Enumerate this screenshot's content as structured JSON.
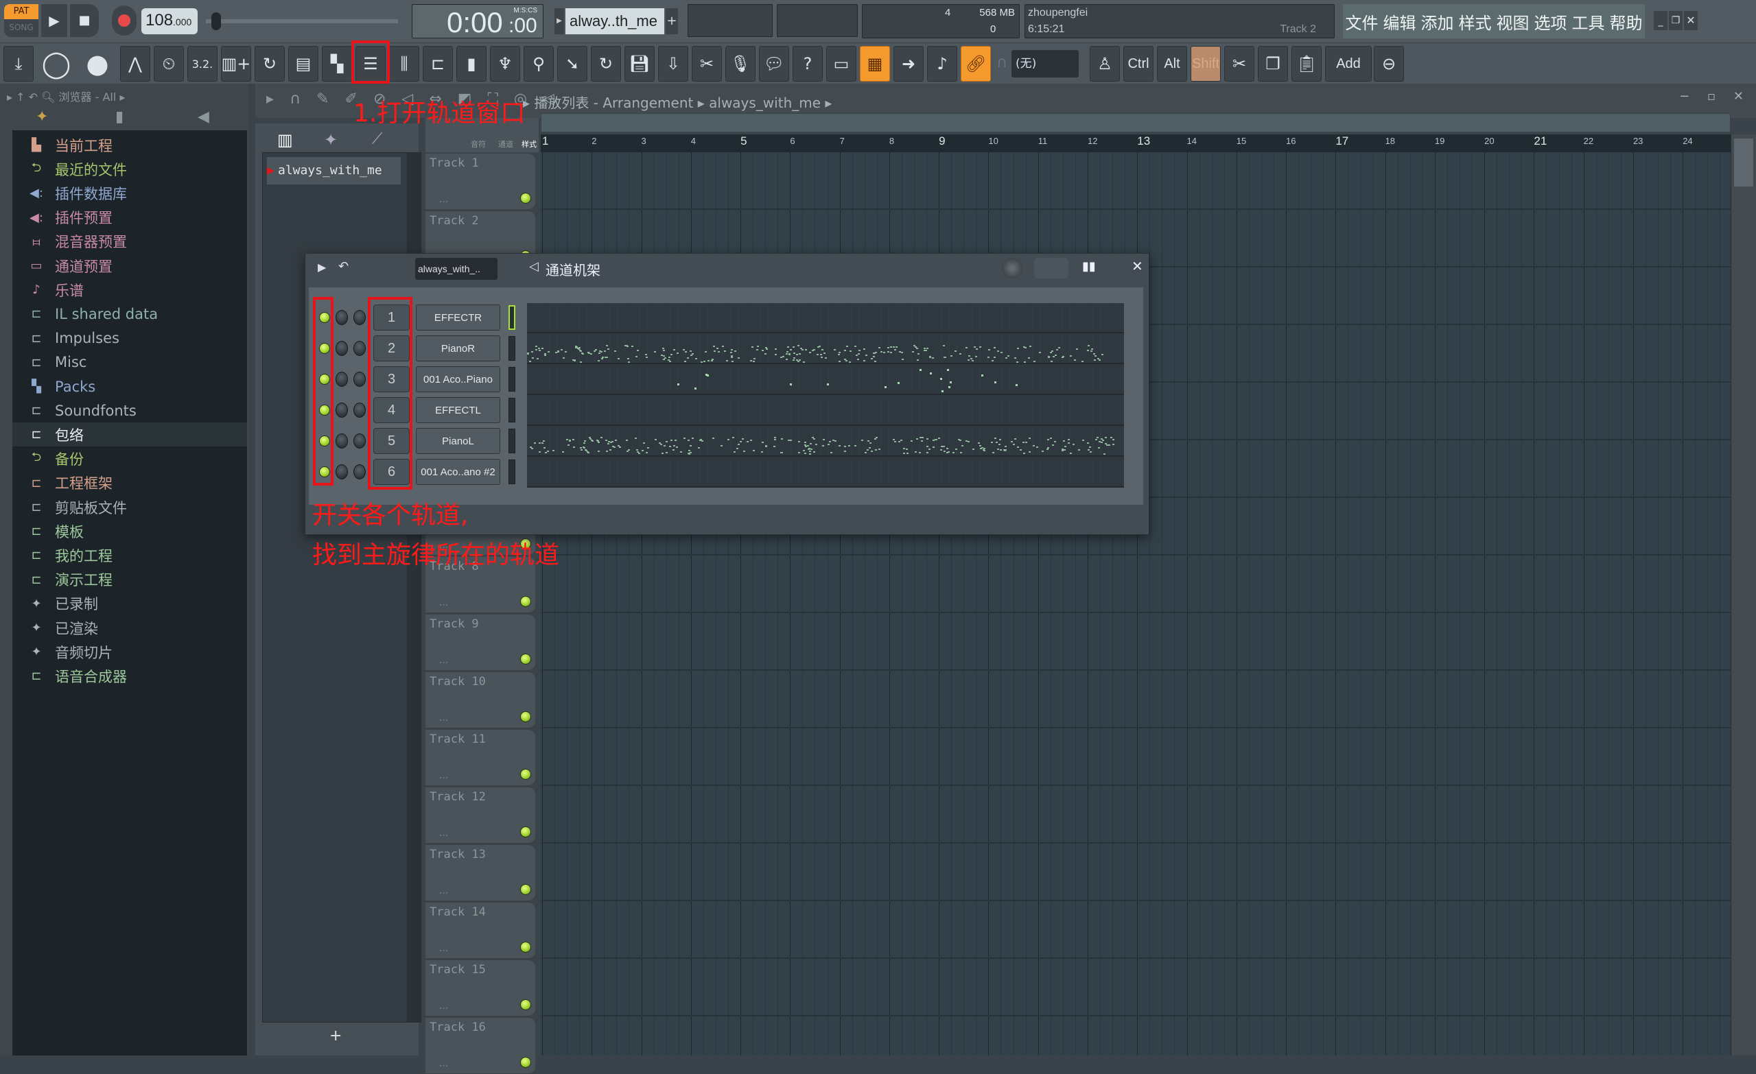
{
  "transport": {
    "pat": "PAT",
    "song": "SONG",
    "tempo": "108",
    "tempo_decimals": ".000",
    "time": "0:00",
    "time_cs": ":00",
    "time_format": "M:S:CS",
    "pattern": "alway..th_me",
    "pattern_add": "+"
  },
  "cpu": {
    "voices": "4",
    "memory": "568 MB",
    "poly": "0"
  },
  "hint": {
    "user": "zhoupengfei",
    "time": "6:15:21",
    "track": "Track 2"
  },
  "menu": [
    "文件",
    "编辑",
    "添加",
    "样式",
    "视图",
    "选项",
    "工具",
    "帮助"
  ],
  "toolbar": {
    "dropdown": "(无)",
    "ctrl": "Ctrl",
    "alt": "Alt",
    "shift": "Shift",
    "add": "Add"
  },
  "browser": {
    "title": "浏览器 - All",
    "items": [
      {
        "label": "当前工程",
        "icon": "project-icon",
        "color": "#d4a08a"
      },
      {
        "label": "最近的文件",
        "icon": "folder-recent-icon",
        "color": "#a6c56d"
      },
      {
        "label": "插件数据库",
        "icon": "plugin-icon",
        "color": "#8fa8d0"
      },
      {
        "label": "插件预置",
        "icon": "plugin-icon",
        "color": "#c88aa8"
      },
      {
        "label": "混音器预置",
        "icon": "mixer-icon",
        "color": "#c88aa8"
      },
      {
        "label": "通道预置",
        "icon": "channel-icon",
        "color": "#c88aa8"
      },
      {
        "label": "乐谱",
        "icon": "note-icon",
        "color": "#c88aa8"
      },
      {
        "label": "IL shared data",
        "icon": "folder-icon",
        "color": "#8fb0b0"
      },
      {
        "label": "Impulses",
        "icon": "folder-icon",
        "color": "#a9b4ba"
      },
      {
        "label": "Misc",
        "icon": "folder-icon",
        "color": "#a9b4ba"
      },
      {
        "label": "Packs",
        "icon": "packs-icon",
        "color": "#8fa8d0"
      },
      {
        "label": "Soundfonts",
        "icon": "folder-icon",
        "color": "#a9b4ba"
      },
      {
        "label": "包络",
        "icon": "folder-icon",
        "color": "#e8eef0"
      },
      {
        "label": "备份",
        "icon": "folder-recent-icon",
        "color": "#a6c56d"
      },
      {
        "label": "工程框架",
        "icon": "folder-icon",
        "color": "#d4a08a"
      },
      {
        "label": "剪贴板文件",
        "icon": "folder-icon",
        "color": "#a9b4ba"
      },
      {
        "label": "模板",
        "icon": "folder-icon",
        "color": "#9cc89a"
      },
      {
        "label": "我的工程",
        "icon": "folder-icon",
        "color": "#9cc89a"
      },
      {
        "label": "演示工程",
        "icon": "folder-icon",
        "color": "#9cc89a"
      },
      {
        "label": "已录制",
        "icon": "wave-icon",
        "color": "#a9b4ba"
      },
      {
        "label": "已渲染",
        "icon": "wave-icon",
        "color": "#a9b4ba"
      },
      {
        "label": "音频切片",
        "icon": "wave-icon",
        "color": "#a9b4ba"
      },
      {
        "label": "语音合成器",
        "icon": "folder-icon",
        "color": "#9cc89a"
      }
    ]
  },
  "playlist": {
    "breadcrumb": "播放列表 - Arrangement",
    "pattern": "always_with_me",
    "tabs": [
      "音符",
      "通道",
      "样式"
    ],
    "pattern_item": "always_with_me",
    "tracks": [
      {
        "n": 1,
        "label": "Track 1"
      },
      {
        "n": 2,
        "label": "Track 2"
      },
      {
        "n": 8,
        "label": "Track 8"
      },
      {
        "n": 9,
        "label": "Track 9"
      },
      {
        "n": 10,
        "label": "Track 10"
      },
      {
        "n": 11,
        "label": "Track 11"
      },
      {
        "n": 12,
        "label": "Track 12"
      },
      {
        "n": 13,
        "label": "Track 13"
      },
      {
        "n": 14,
        "label": "Track 14"
      },
      {
        "n": 15,
        "label": "Track 15"
      },
      {
        "n": 16,
        "label": "Track 16"
      }
    ],
    "bars": [
      1,
      2,
      3,
      4,
      5,
      6,
      7,
      8,
      9,
      10,
      11,
      12,
      13,
      14,
      15,
      16,
      17,
      18,
      19,
      20,
      21,
      22,
      23,
      24
    ]
  },
  "rack": {
    "title": "通道机架",
    "pattern": "always_with_..",
    "channels": [
      {
        "num": "1",
        "name": "EFFECTR",
        "selected": true
      },
      {
        "num": "2",
        "name": "PianoR"
      },
      {
        "num": "3",
        "name": "001 Aco..Piano"
      },
      {
        "num": "4",
        "name": "EFFECTL"
      },
      {
        "num": "5",
        "name": "PianoL"
      },
      {
        "num": "6",
        "name": "001 Aco..ano #2"
      }
    ]
  },
  "annotations": {
    "open": "1.打开轨道窗口",
    "toggle": "开关各个轨道,",
    "find": "找到主旋律所在的轨道"
  },
  "colors": {
    "accent": "#f59a2e",
    "led": "#9bd12a",
    "annotation": "#ff1a1a"
  }
}
